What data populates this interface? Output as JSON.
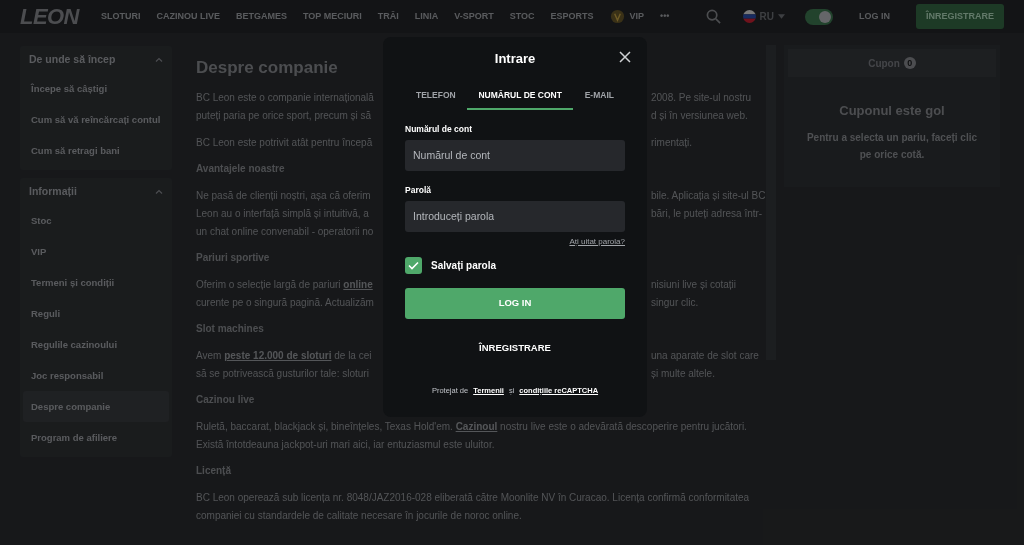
{
  "header": {
    "logo": "LEON",
    "nav": [
      {
        "label": "SLOTURI",
        "kind": "text"
      },
      {
        "label": "CAZINOU LIVE",
        "kind": "text"
      },
      {
        "label": "BETGAMES",
        "kind": "text"
      },
      {
        "label": "TOP MECIURI",
        "kind": "text"
      },
      {
        "label": "TRĂI",
        "kind": "text"
      },
      {
        "label": "LINIA",
        "kind": "text"
      },
      {
        "label": "V-SPORT",
        "kind": "text"
      },
      {
        "label": "STOC",
        "kind": "text"
      },
      {
        "label": "ESPORTS",
        "kind": "text"
      },
      {
        "label": "VIP",
        "kind": "vip"
      },
      {
        "label": "•••",
        "kind": "text"
      }
    ],
    "language": "RU",
    "dark_mode": true,
    "login": "LOG IN",
    "register": "ÎNREGISTRARE"
  },
  "sidebar": {
    "sections": [
      {
        "title": "De unde să încep",
        "expanded": true,
        "items": [
          {
            "label": "Începe să câștigi",
            "selected": false
          },
          {
            "label": "Cum să vă reîncărcați contul",
            "selected": false
          },
          {
            "label": "Cum să retragi bani",
            "selected": false
          }
        ]
      },
      {
        "title": "Informații",
        "expanded": true,
        "items": [
          {
            "label": "Stoc",
            "selected": false
          },
          {
            "label": "VIP",
            "selected": false
          },
          {
            "label": "Termeni și condiții",
            "selected": false
          },
          {
            "label": "Reguli",
            "selected": false
          },
          {
            "label": "Regulile cazinoului",
            "selected": false
          },
          {
            "label": "Joc responsabil",
            "selected": false
          },
          {
            "label": "Despre companie",
            "selected": true
          },
          {
            "label": "Program de afiliere",
            "selected": false
          }
        ]
      }
    ]
  },
  "article": {
    "title": "Despre companie",
    "blocks": [
      {
        "kind": "paragraph",
        "lines": [
          {
            "left": [
              {
                "text": "BC Leon este o companie internațională"
              }
            ],
            "right": [
              {
                "text": "2008. Pe site-ul nostru"
              }
            ]
          },
          {
            "left": [
              {
                "text": "puteți paria pe orice sport, precum și să"
              }
            ],
            "right": [
              {
                "text": "d și în versiunea web."
              }
            ]
          }
        ]
      },
      {
        "kind": "paragraph",
        "lines": [
          {
            "left": [
              {
                "text": "BC Leon este potrivit atât pentru începă"
              }
            ],
            "right": [
              {
                "text": "rimentați."
              }
            ]
          }
        ]
      },
      {
        "kind": "heading",
        "text": "Avantajele noastre"
      },
      {
        "kind": "paragraph",
        "lines": [
          {
            "left": [
              {
                "text": "Ne pasă de clienții noștri, așa că oferim"
              }
            ],
            "right": [
              {
                "text": "bile. Aplicația și site-ul BC"
              }
            ]
          },
          {
            "left": [
              {
                "text": "Leon au o interfață simplă și intuitivă, a"
              }
            ],
            "right": [
              {
                "text": "bări, le puteți adresa într-"
              }
            ]
          },
          {
            "left": [
              {
                "text": "un chat online convenabil - operatorii no"
              }
            ]
          }
        ]
      },
      {
        "kind": "heading",
        "text": "Pariuri sportive"
      },
      {
        "kind": "paragraph",
        "lines": [
          {
            "left": [
              {
                "text": "Oferim o selecție largă de pariuri "
              },
              {
                "text": "online",
                "link": true
              }
            ],
            "right": [
              {
                "text": "nisiuni live și cotații"
              }
            ]
          },
          {
            "left": [
              {
                "text": "curente pe o singură pagină. Actualizăm"
              }
            ],
            "right": [
              {
                "text": "singur clic."
              }
            ]
          }
        ]
      },
      {
        "kind": "heading",
        "text": "Slot machines"
      },
      {
        "kind": "paragraph",
        "lines": [
          {
            "left": [
              {
                "text": "Avem "
              },
              {
                "text": "peste 12.000 de sloturi",
                "link": true
              },
              {
                "text": " de la cei"
              }
            ],
            "right": [
              {
                "text": "una aparate de slot care"
              }
            ]
          },
          {
            "left": [
              {
                "text": "să se potrivească gusturilor tale: sloturi"
              }
            ],
            "right": [
              {
                "text": "și multe altele."
              }
            ]
          }
        ]
      },
      {
        "kind": "heading",
        "text": "Cazinou live"
      },
      {
        "kind": "paragraph",
        "lines": [
          {
            "full": [
              {
                "text": "Ruletă, baccarat, blackjack și, bineînțeles, Texas Hold'em. "
              },
              {
                "text": "Cazinoul",
                "link": true
              },
              {
                "text": " nostru live este o adevărată descoperire pentru jucători."
              }
            ]
          },
          {
            "full": [
              {
                "text": "Există întotdeauna jackpot-uri mari aici, iar entuziasmul este uluitor."
              }
            ]
          }
        ]
      },
      {
        "kind": "heading",
        "text": "Licență"
      },
      {
        "kind": "paragraph",
        "lines": [
          {
            "full": [
              {
                "text": "BC Leon operează sub licența nr. 8048/JAZ2016-028 eliberată către Moonlite NV în Curacao. Licența confirmă conformitatea"
              }
            ]
          },
          {
            "full": [
              {
                "text": "companiei cu standardele de calitate necesare în jocurile de noroc online."
              }
            ]
          }
        ]
      }
    ]
  },
  "coupon": {
    "tab": "Cupon",
    "count": "0",
    "title": "Cuponul este gol",
    "text": "Pentru a selecta un pariu, faceți clic pe orice cotă."
  },
  "modal": {
    "title": "Intrare",
    "tabs": [
      {
        "label": "TELEFON",
        "selected": false
      },
      {
        "label": "NUMĂRUL DE CONT",
        "selected": true
      },
      {
        "label": "E-MAIL",
        "selected": false
      }
    ],
    "fields": [
      {
        "label": "Numărul de cont",
        "placeholder": "Numărul de cont"
      },
      {
        "label": "Parolă",
        "placeholder": "Introduceți parola"
      }
    ],
    "forgot": "Ați uitat parola?",
    "remember": {
      "label": "Salvați parola",
      "checked": true
    },
    "login": "LOG IN",
    "register": "ÎNREGISTRARE",
    "footer": [
      {
        "text": "Protejat de",
        "link": false
      },
      {
        "text": "Termenii",
        "link": true
      },
      {
        "text": "și",
        "link": false
      },
      {
        "text": "condițiile reCAPTCHA",
        "link": true
      }
    ]
  }
}
